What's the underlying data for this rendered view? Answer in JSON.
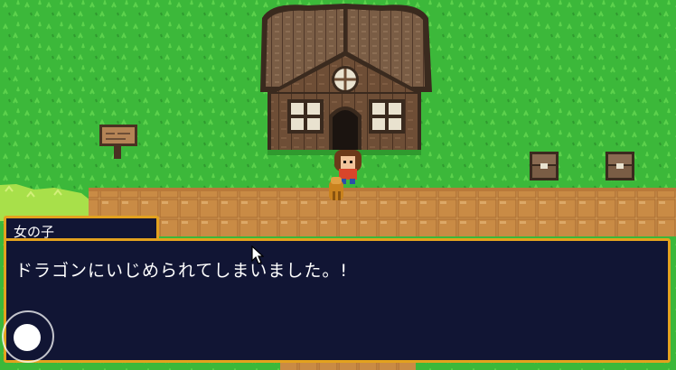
{
  "dialog": {
    "speaker": "女の子",
    "message": "ドラゴンにいじめられてしまいました。!"
  },
  "colors": {
    "grass": "#3cb83a",
    "panel": "#111534",
    "border": "#e3a21e",
    "text": "#ffffff"
  },
  "icons": {
    "joystick": "virtual-joystick-icon",
    "cursor": "mouse-pointer-icon"
  }
}
